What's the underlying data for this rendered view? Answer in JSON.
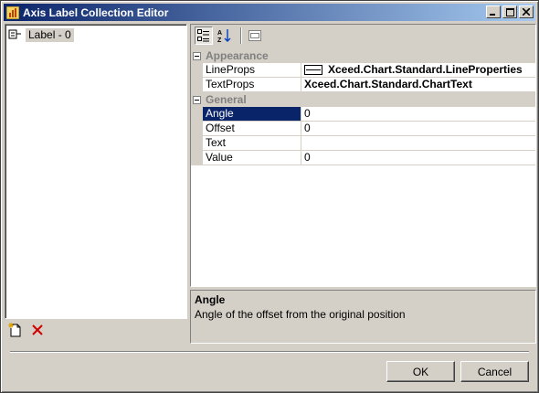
{
  "window": {
    "title": "Axis Label Collection Editor",
    "controls": {
      "minimize": "minimize",
      "maximize": "maximize",
      "close": "close"
    }
  },
  "members": {
    "items": [
      {
        "label": "Label - 0",
        "icon": "label-item-icon"
      }
    ],
    "tools": {
      "add_icon": "new-document-icon",
      "remove_icon": "red-x-delete-icon"
    }
  },
  "property_grid": {
    "toolbar": {
      "categorized_icon": "categorized-icon",
      "alphabetical_icon": "sort-az-icon",
      "property_pages_icon": "property-pages-icon"
    },
    "categories": [
      {
        "name": "Appearance",
        "properties": [
          {
            "name": "LineProps",
            "value": "Xceed.Chart.Standard.LineProperties"
          },
          {
            "name": "TextProps",
            "value": "Xceed.Chart.Standard.ChartText"
          }
        ]
      },
      {
        "name": "General",
        "properties": [
          {
            "name": "Angle",
            "value": "0"
          },
          {
            "name": "Offset",
            "value": "0"
          },
          {
            "name": "Text",
            "value": ""
          },
          {
            "name": "Value",
            "value": "0"
          }
        ]
      }
    ],
    "selected_property": "Angle"
  },
  "description": {
    "title": "Angle",
    "text": "Angle of the offset from the original position"
  },
  "buttons": {
    "ok": "OK",
    "cancel": "Cancel"
  },
  "colors": {
    "title_active": "#0a246a",
    "title_gradient_end": "#a6caf0",
    "selection": "#0a246a",
    "face": "#d4d0c8"
  }
}
